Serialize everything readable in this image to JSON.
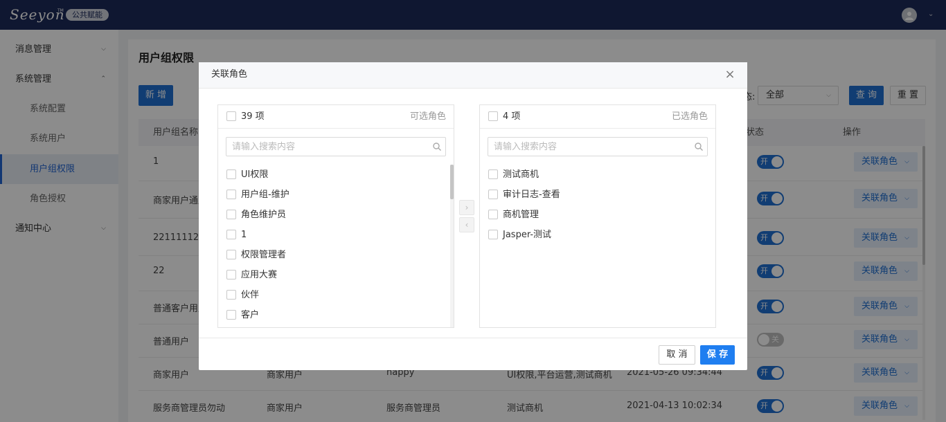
{
  "header": {
    "logo_text": "Seeyon",
    "logo_tm": "TM",
    "badge": "公共赋能"
  },
  "sidebar": {
    "items": [
      {
        "label": "消息管理",
        "chevron": "⌄"
      },
      {
        "label": "系统管理",
        "chevron": "⌃"
      },
      {
        "label": "系统配置"
      },
      {
        "label": "系统用户"
      },
      {
        "label": "用户组权限"
      },
      {
        "label": "角色授权"
      },
      {
        "label": "通知中心",
        "chevron": "⌄"
      }
    ]
  },
  "page": {
    "title": "用户组权限",
    "new_button": "新 增",
    "filter_label": "态:",
    "filter_value": "全部",
    "query_button": "查 询",
    "reset_button": "重 置"
  },
  "table": {
    "headers": {
      "name": "用户组名称",
      "status": "状态",
      "action": "操作"
    },
    "rows": [
      {
        "name": "1",
        "type": "",
        "desc": "",
        "roles": "",
        "time": "",
        "status": "开",
        "on": true,
        "action": "关联角色"
      },
      {
        "name": "商家用户通用",
        "type": "",
        "desc": "",
        "roles": "",
        "time": "",
        "status": "开",
        "on": true,
        "action": "关联角色"
      },
      {
        "name": "22111112",
        "type": "",
        "desc": "",
        "roles": "",
        "time": "",
        "status": "开",
        "on": true,
        "action": "关联角色"
      },
      {
        "name": "22",
        "type": "",
        "desc": "",
        "roles": "",
        "time": "",
        "status": "开",
        "on": true,
        "action": "关联角色"
      },
      {
        "name": "普通客户用户",
        "type": "",
        "desc": "",
        "roles": "",
        "time": "",
        "status": "开",
        "on": true,
        "action": "关联角色"
      },
      {
        "name": "普通用户",
        "type": "",
        "desc": "",
        "roles": "",
        "time": "",
        "status": "关",
        "on": false,
        "action": "关联角色"
      },
      {
        "name": "商家用户",
        "type": "商家用户",
        "desc": "happy",
        "roles": "UI权限,平台运营,测试商机",
        "time": "2021-05-26 09:34:44",
        "status": "开",
        "on": true,
        "action": "关联角色"
      },
      {
        "name": "服务商管理员勿动",
        "type": "商家用户",
        "desc": "服务商管理员",
        "roles": "测试商机",
        "time": "2021-04-13 10:02:34",
        "status": "开",
        "on": true,
        "action": "关联角色"
      }
    ]
  },
  "modal": {
    "title": "关联角色",
    "close": "×",
    "left": {
      "count": "39 项",
      "label": "可选角色",
      "placeholder": "请输入搜索内容",
      "items": [
        "UI权限",
        "用户组-维护",
        "角色维护员",
        "1",
        "权限管理者",
        "应用大赛",
        "伙伴",
        "客户"
      ]
    },
    "right": {
      "count": "4 项",
      "label": "已选角色",
      "placeholder": "请输入搜索内容",
      "items": [
        "测试商机",
        "审计日志-查看",
        "商机管理",
        "Jasper-测试"
      ]
    },
    "move_right": "›",
    "move_left": "‹",
    "cancel": "取 消",
    "save": "保 存"
  },
  "colors": {
    "header_bg": "#1c2a5a",
    "primary": "#1f6fd1",
    "save": "#1f7ef0"
  }
}
